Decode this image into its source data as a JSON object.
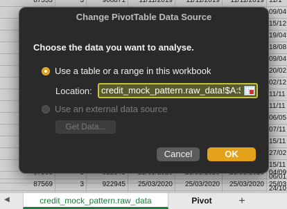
{
  "sheet": {
    "rows": [
      [
        "87553",
        "3",
        "908871",
        "11/11/2019",
        "11/11/2019",
        "11/11/2019",
        "11/1"
      ],
      [
        "",
        "",
        "",
        "",
        "",
        "",
        "09/04"
      ],
      [
        "",
        "",
        "",
        "",
        "",
        "",
        "15/12"
      ],
      [
        "",
        "",
        "",
        "",
        "",
        "",
        "19/04"
      ],
      [
        "",
        "",
        "",
        "",
        "",
        "",
        "18/08"
      ],
      [
        "",
        "",
        "",
        "",
        "",
        "",
        "09/04"
      ],
      [
        "",
        "",
        "",
        "",
        "",
        "",
        "20/02"
      ],
      [
        "",
        "",
        "",
        "",
        "",
        "",
        "02/12"
      ],
      [
        "",
        "",
        "",
        "",
        "",
        "",
        "11/11"
      ],
      [
        "",
        "",
        "",
        "",
        "",
        "",
        "11/11"
      ],
      [
        "",
        "",
        "",
        "",
        "",
        "",
        "06/05"
      ],
      [
        "",
        "",
        "",
        "",
        "",
        "",
        "07/11"
      ],
      [
        "",
        "",
        "",
        "",
        "",
        "",
        "15/11"
      ],
      [
        "",
        "",
        "",
        "",
        "",
        "",
        "27/02"
      ],
      [
        "",
        "",
        "",
        "",
        "",
        "",
        "15/11"
      ],
      [
        "",
        "",
        "",
        "",
        "",
        "",
        "06/01"
      ],
      [
        "",
        "",
        "",
        "",
        "",
        "",
        "24/10"
      ],
      [
        "87568",
        "3",
        "922945",
        "25/03/2020",
        "25/03/2020",
        "25/03/2020",
        "04/09"
      ],
      [
        "87569",
        "3",
        "922945",
        "25/03/2020",
        "25/03/2020",
        "25/03/2020",
        "25/03"
      ]
    ]
  },
  "tabs": {
    "active": "credit_mock_pattern.raw_data",
    "pivot": "Pivot",
    "add": "+"
  },
  "dialog": {
    "title": "Change PivotTable Data Source",
    "heading": "Choose the data you want to analyse.",
    "option_table": "Use a table or a range in this workbook",
    "location_label": "Location:",
    "location_value": "credit_mock_pattern.raw_data!$A:$P",
    "option_external": "Use an external data source",
    "get_data": "Get Data...",
    "cancel": "Cancel",
    "ok": "OK"
  },
  "colors": {
    "accent": "#e3a21a",
    "dialog_bg": "#2a2a2a",
    "active_tab_text": "#1e7b3d",
    "location_border": "#c9c33a"
  }
}
